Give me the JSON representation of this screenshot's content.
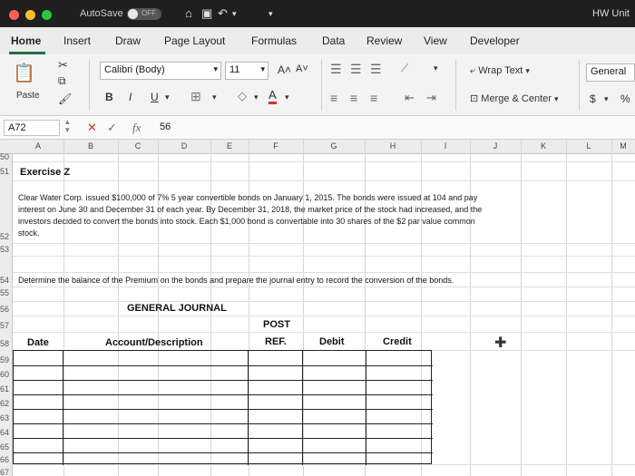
{
  "titlebar": {
    "autosave": "AutoSave",
    "autosave_state": "OFF",
    "window_title": "HW Unit"
  },
  "tabs": [
    "Home",
    "Insert",
    "Draw",
    "Page Layout",
    "Formulas",
    "Data",
    "Review",
    "View",
    "Developer"
  ],
  "ribbon": {
    "paste": "Paste",
    "font_name": "Calibri (Body)",
    "font_size": "11",
    "bold": "B",
    "italic": "I",
    "underline": "U",
    "grow_font": "A˄",
    "shrink_font": "A˅",
    "wrap_text": "Wrap Text",
    "merge_center": "Merge & Center",
    "number_format": "General",
    "currency": "$",
    "percent": "%"
  },
  "formula_bar": {
    "name_box": "A72",
    "fx": "fx",
    "value": "56"
  },
  "columns": [
    "A",
    "B",
    "C",
    "D",
    "E",
    "F",
    "G",
    "H",
    "I",
    "J",
    "K",
    "L",
    "M"
  ],
  "rows": [
    "50",
    "51",
    "52",
    "53",
    "54",
    "55",
    "56",
    "57",
    "58",
    "59",
    "60",
    "61",
    "62",
    "63",
    "64",
    "65",
    "66",
    "67"
  ],
  "sheet": {
    "exercise_title": "Exercise Z",
    "paragraph": [
      "Clear Water Corp. issued $100,000 of 7% 5 year convertible bonds on January 1, 2015. The bonds were issued at 104 and pay",
      "interest on June 30 and December 31 of each year. By December 31, 2018, the market price of the stock had increased, and the",
      "investors decided to convert the bonds into stock. Each $1,000 bond is convertable into 30 shares of the $2 par value common",
      "stock."
    ],
    "instruction": "Determine the balance of the Premium on the bonds and prepare the journal entry to record the conversion of the bonds.",
    "journal_title": "GENERAL JOURNAL",
    "headers": {
      "date": "Date",
      "account": "Account/Description",
      "post": "POST",
      "ref": "REF.",
      "debit": "Debit",
      "credit": "Credit"
    }
  }
}
